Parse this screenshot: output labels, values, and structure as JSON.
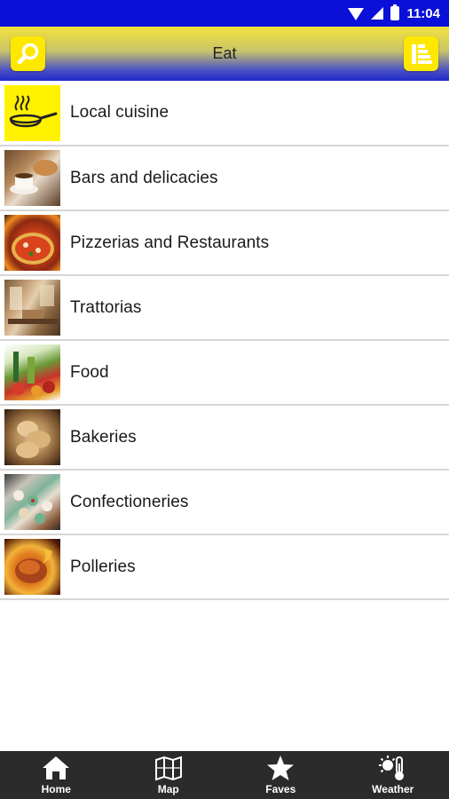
{
  "status_bar": {
    "time": "11:04",
    "icons": [
      "wifi-icon",
      "signal-icon",
      "battery-icon"
    ],
    "background": "#0a10d8"
  },
  "app_bar": {
    "title": "Eat",
    "left_button_icon": "search-icon",
    "right_button_icon": "list-sort-icon",
    "accent": "#ffe800"
  },
  "categories": [
    {
      "label": "Local cuisine",
      "icon": "frying-pan-icon"
    },
    {
      "label": "Bars and delicacies",
      "icon": "coffee-pastry-photo"
    },
    {
      "label": "Pizzerias and Restaurants",
      "icon": "pizza-photo"
    },
    {
      "label": "Trattorias",
      "icon": "trattoria-interior-photo"
    },
    {
      "label": "Food",
      "icon": "groceries-photo"
    },
    {
      "label": "Bakeries",
      "icon": "bread-photo"
    },
    {
      "label": "Confectioneries",
      "icon": "pastries-photo"
    },
    {
      "label": "Polleries",
      "icon": "roast-chicken-photo"
    }
  ],
  "bottom_nav": [
    {
      "label": "Home",
      "icon": "home-icon"
    },
    {
      "label": "Map",
      "icon": "map-icon"
    },
    {
      "label": "Faves",
      "icon": "star-icon"
    },
    {
      "label": "Weather",
      "icon": "weather-icon"
    }
  ]
}
